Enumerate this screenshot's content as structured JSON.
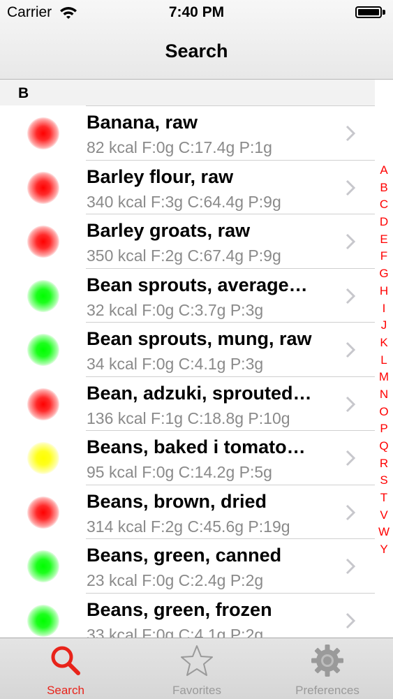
{
  "status_bar": {
    "carrier": "Carrier",
    "time": "7:40 PM"
  },
  "nav": {
    "title": "Search"
  },
  "section": {
    "header": "B"
  },
  "colors": {
    "accent": "#ff0000",
    "tab_active": "#e8231a",
    "detail_text": "#8a8a8a"
  },
  "items": [
    {
      "name": "Banana, raw",
      "detail": "82 kcal F:0g C:17.4g P:1g",
      "indicator": "red"
    },
    {
      "name": "Barley flour, raw",
      "detail": "340 kcal F:3g C:64.4g P:9g",
      "indicator": "red"
    },
    {
      "name": "Barley groats, raw",
      "detail": "350 kcal F:2g C:67.4g P:9g",
      "indicator": "red"
    },
    {
      "name": "Bean sprouts, average…",
      "detail": "32 kcal F:0g C:3.7g P:3g",
      "indicator": "green"
    },
    {
      "name": "Bean sprouts, mung, raw",
      "detail": "34 kcal F:0g C:4.1g P:3g",
      "indicator": "green"
    },
    {
      "name": "Bean, adzuki, sprouted…",
      "detail": "136 kcal F:1g C:18.8g P:10g",
      "indicator": "red"
    },
    {
      "name": "Beans, baked i tomato…",
      "detail": "95 kcal F:0g C:14.2g P:5g",
      "indicator": "yellow"
    },
    {
      "name": "Beans, brown, dried",
      "detail": "314 kcal F:2g C:45.6g P:19g",
      "indicator": "red"
    },
    {
      "name": "Beans, green, canned",
      "detail": "23 kcal F:0g C:2.4g P:2g",
      "indicator": "green"
    },
    {
      "name": "Beans, green, frozen",
      "detail": "33 kcal F:0g C:4.1g P:2g",
      "indicator": "green"
    }
  ],
  "index_letters": [
    "A",
    "B",
    "C",
    "D",
    "E",
    "F",
    "G",
    "H",
    "I",
    "J",
    "K",
    "L",
    "M",
    "N",
    "O",
    "P",
    "Q",
    "R",
    "S",
    "T",
    "V",
    "W",
    "Y"
  ],
  "tabs": [
    {
      "label": "Search",
      "icon": "search-icon",
      "active": true
    },
    {
      "label": "Favorites",
      "icon": "star-icon",
      "active": false
    },
    {
      "label": "Preferences",
      "icon": "gear-icon",
      "active": false
    }
  ]
}
